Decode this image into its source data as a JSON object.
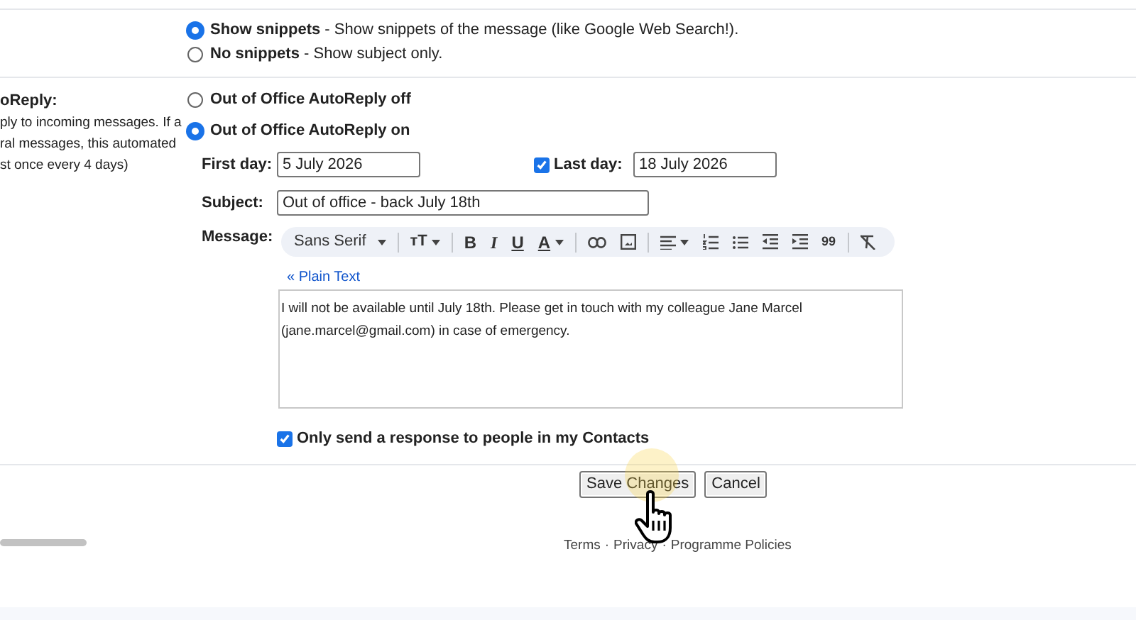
{
  "snippets": [
    {
      "label": "Show snippets",
      "description": " - Show snippets of the message (like Google Web Search!).",
      "selected": true
    },
    {
      "label": "No snippets",
      "description": " - Show subject only.",
      "selected": false
    }
  ],
  "autoreply": {
    "heading": "oReply:",
    "description": [
      "ply to incoming messages. If a",
      "ral messages, this automated",
      "st once every 4 days)"
    ],
    "options": [
      {
        "label": "Out of Office AutoReply off",
        "selected": false
      },
      {
        "label": "Out of Office AutoReply on",
        "selected": true
      }
    ],
    "first_day": {
      "label": "First day:",
      "value": "5 July 2026"
    },
    "last_day": {
      "label": "Last day:",
      "value": "18 July 2026",
      "checked": true
    },
    "subject": {
      "label": "Subject:",
      "value": "Out of office - back July 18th"
    },
    "message_label": "Message:",
    "toolbar": {
      "font": "Sans Serif",
      "size": "тT",
      "bold": "B",
      "italic": "I",
      "underline": "U",
      "text_color": "A",
      "quote": "99"
    },
    "plain_text_link": "« Plain Text",
    "message": [
      "I will not be available until July 18th. Please get in touch with my colleague Jane Marcel",
      "(jane.marcel@gmail.com) in case of emergency."
    ],
    "contacts_only": {
      "label": "Only send a response to people in my Contacts",
      "checked": true
    }
  },
  "buttons": [
    "Save Changes",
    "Cancel"
  ],
  "footer": {
    "links": [
      "Terms",
      "Privacy",
      "Programme Policies"
    ],
    "separator": "·"
  }
}
